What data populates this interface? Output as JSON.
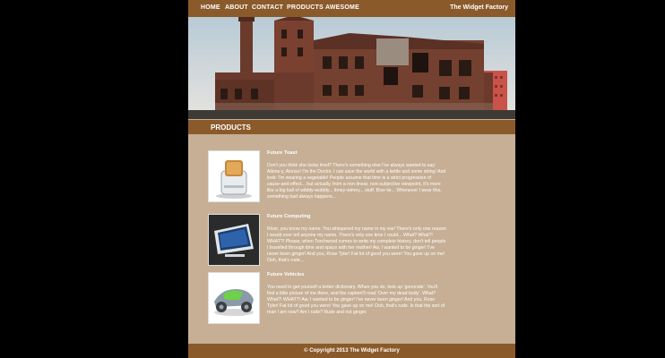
{
  "nav": {
    "items": [
      {
        "label": "HOME"
      },
      {
        "label": "ABOUT"
      },
      {
        "label": "CONTACT"
      },
      {
        "label": "PRODUCTS"
      },
      {
        "label": "AWESOME"
      }
    ],
    "brand": "The Widget Factory"
  },
  "section": {
    "title": "PRODUCTS"
  },
  "products": [
    {
      "name": "Future Toast",
      "description": "Don't you think she looks tired? There's something else I've always wanted to say: Allons-y, Alonso! I'm the Doctor, I can save the world with a kettle and some string! And look: I'm wearing a vegetable! People assume that time is a strict progression of cause-and-effect... but actually, from a non-linear, non-subjective viewpoint, it's more like a big ball of wibbly-wobbly... timey-wimey... stuff. Bow tie... Whenever I wear this, something bad always happens..."
    },
    {
      "name": "Future Computing",
      "description": "River, you know my name. You whispered my name in my ear! There's only one reason I would ever tell anyone my name. There's only one time I could... What? What?! WHAT?! Please, when Torchwood comes to write my complete history, don't tell people I travelled through time and space with her mother! Aw, I wanted to be ginger! I've never been ginger! And you, Rose Tyler! Fat lot of good you were! You gave up on me! Ooh, that's rude..."
    },
    {
      "name": "Future Vehicles",
      "description": "You need to get yourself a better dictionary. When you do, look up 'genocide'. You'll find a little picture of me there, and the caption'll read 'Over my dead body'. What? What?! WHAT?! Aw, I wanted to be ginger! I've never been ginger! And you, Rose Tyler! Fat lot of good you were! You gave up on me! Ooh, that's rude. Is that the sort of man I am now? Am I rude? Rude and not ginger."
    }
  ],
  "footer": {
    "copyright": "© Copyright 2013 The Widget Factory"
  },
  "colors": {
    "bar": "#8b5a2b",
    "content_bg": "#c6af94",
    "outer_bg": "#000000"
  }
}
